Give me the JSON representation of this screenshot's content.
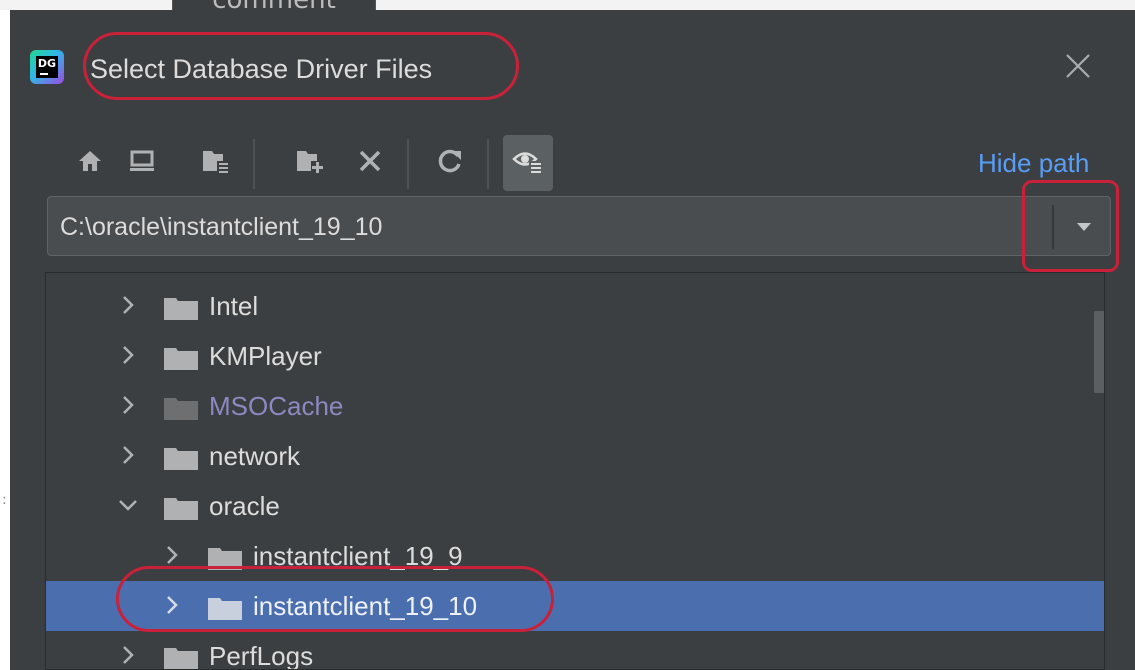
{
  "background_tab": {
    "label": "comment"
  },
  "dialog": {
    "title": "Select Database Driver Files",
    "app_icon": {
      "name": "datagrip-icon",
      "text": "DG"
    },
    "toolbar": {
      "buttons": [
        {
          "icon": "home-icon"
        },
        {
          "icon": "desktop-icon"
        },
        {
          "icon": "project-folder-icon"
        },
        {
          "icon": "new-folder-icon"
        },
        {
          "icon": "delete-icon"
        },
        {
          "icon": "refresh-icon"
        },
        {
          "icon": "show-hidden-icon",
          "active": true
        }
      ],
      "hide_path_label": "Hide path"
    },
    "path": {
      "value": "C:\\oracle\\instantclient_19_10"
    },
    "tree": {
      "rows": [
        {
          "label": "Intel",
          "level": 0,
          "expanded": false,
          "dim": false,
          "selected": false
        },
        {
          "label": "KMPlayer",
          "level": 0,
          "expanded": false,
          "dim": false,
          "selected": false
        },
        {
          "label": "MSOCache",
          "level": 0,
          "expanded": false,
          "dim": true,
          "selected": false
        },
        {
          "label": "network",
          "level": 0,
          "expanded": false,
          "dim": false,
          "selected": false
        },
        {
          "label": "oracle",
          "level": 0,
          "expanded": true,
          "dim": false,
          "selected": false
        },
        {
          "label": "instantclient_19_9",
          "level": 1,
          "expanded": false,
          "dim": false,
          "selected": false
        },
        {
          "label": "instantclient_19_10",
          "level": 1,
          "expanded": false,
          "dim": false,
          "selected": true
        },
        {
          "label": "PerfLogs",
          "level": 0,
          "expanded": false,
          "dim": false,
          "selected": false
        }
      ]
    }
  },
  "colors": {
    "dialog_bg": "#3c3f41",
    "selection": "#4b6eaf",
    "link": "#589df6",
    "annotation": "#c9213a",
    "text": "#dcdcdc"
  }
}
